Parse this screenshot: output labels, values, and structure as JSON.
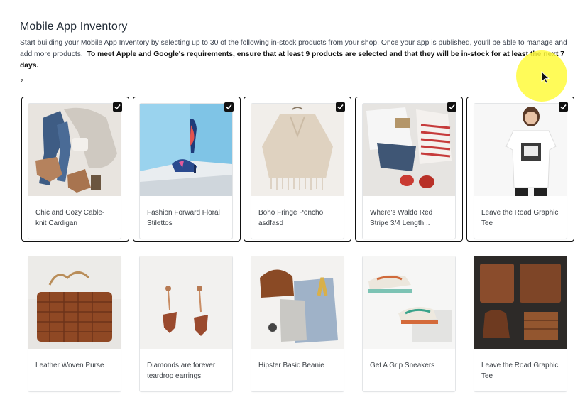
{
  "header": {
    "title": "Mobile App Inventory",
    "description_1": "Start building your Mobile App Inventory by selecting up to 30 of the following in-stock products from your shop.    Once your app is published, you'll be able to manage and add more products.",
    "description_2": "To meet Apple and Google's requirements, ensure that at least 9 products are selected and that they will be in-stock for at least the",
    "description_highlight": "next 7 days",
    "description_end": ".",
    "stray_text": "z"
  },
  "products": [
    {
      "name": "Chic and Cozy Cable-knit Cardigan",
      "selected": true,
      "image": "flatlay-denim-icon"
    },
    {
      "name": "Fashion Forward Floral Stilettos",
      "selected": true,
      "image": "stiletto-icon"
    },
    {
      "name": "Boho Fringe Poncho asdfasd",
      "selected": true,
      "image": "poncho-icon"
    },
    {
      "name": "Where's Waldo Red Stripe 3/4 Length...",
      "selected": true,
      "image": "striped-shirt-icon"
    },
    {
      "name": "Leave the Road Graphic Tee",
      "selected": true,
      "image": "graphic-tee-icon"
    },
    {
      "name": "Leather Woven Purse",
      "selected": false,
      "image": "purse-icon"
    },
    {
      "name": "Diamonds are forever teardrop earrings",
      "selected": false,
      "image": "earrings-icon"
    },
    {
      "name": "Hipster Basic Beanie",
      "selected": false,
      "image": "beanie-icon"
    },
    {
      "name": "Get A Grip Sneakers",
      "selected": false,
      "image": "sneakers-icon"
    },
    {
      "name": "Leave the Road Graphic Tee",
      "selected": false,
      "image": "sweater-flatlay-icon"
    }
  ]
}
